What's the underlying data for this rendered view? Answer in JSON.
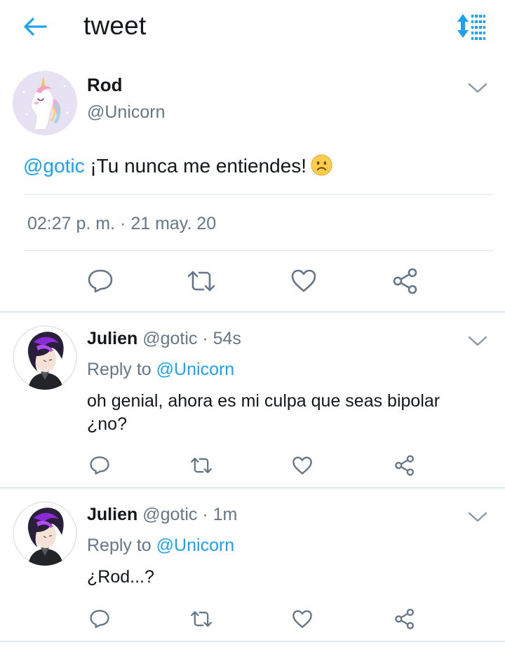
{
  "header": {
    "title": "tweet",
    "accent_color": "#1da1f2"
  },
  "main_tweet": {
    "author_name": "Rod",
    "author_handle": "@Unicorn",
    "mention": "@gotic",
    "text": "¡Tu nunca me entiendes!",
    "emoji": "frowning-face-emoji",
    "time": "02:27 p. m.",
    "separator": "·",
    "date": "21 may. 20"
  },
  "replies": [
    {
      "author_name": "Julien",
      "author_handle": "@gotic",
      "age": "54s",
      "reply_prefix": "Reply to",
      "reply_to": "@Unicorn",
      "text": "oh genial, ahora es mi culpa que seas bipolar ¿no?"
    },
    {
      "author_name": "Julien",
      "author_handle": "@gotic",
      "age": "1m",
      "reply_prefix": "Reply to",
      "reply_to": "@Unicorn",
      "text": "¿Rod...?"
    }
  ],
  "icons": {
    "back": "back-arrow-icon",
    "sort": "sort-icon",
    "reply": "reply-icon",
    "retweet": "retweet-icon",
    "like": "like-icon",
    "share": "share-icon",
    "chevron": "chevron-down-icon"
  }
}
